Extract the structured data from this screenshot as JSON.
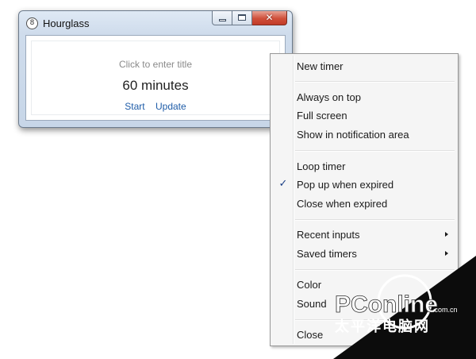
{
  "window": {
    "title": "Hourglass",
    "icon": "hourglass-app-icon",
    "icon_glyph": "8",
    "caption_buttons": {
      "minimize_icon": "minimize-icon",
      "maximize_icon": "maximize-icon",
      "close_icon": "close-icon",
      "close_glyph": "✕"
    },
    "title_placeholder": "Click to enter title",
    "timer_input": "60 minutes",
    "start_label": "Start",
    "update_label": "Update"
  },
  "menu": {
    "items": [
      {
        "label": "New timer"
      },
      {
        "label": "Always on top"
      },
      {
        "label": "Full screen"
      },
      {
        "label": "Show in notification area"
      },
      {
        "label": "Loop timer"
      },
      {
        "label": "Pop up when expired",
        "checked": true
      },
      {
        "label": "Close when expired"
      },
      {
        "label": "Recent inputs",
        "submenu": true
      },
      {
        "label": "Saved timers",
        "submenu": true
      },
      {
        "label": "Color"
      },
      {
        "label": "Sound"
      },
      {
        "label": "Close"
      }
    ],
    "check_glyph": "✓"
  },
  "watermark": {
    "brand": "PConline",
    "suffix": ".com.cn",
    "chinese": "太平洋电脑网"
  },
  "colors": {
    "link": "#1e5ca8",
    "close_button": "#cf4f3a",
    "check": "#1b3f86"
  }
}
